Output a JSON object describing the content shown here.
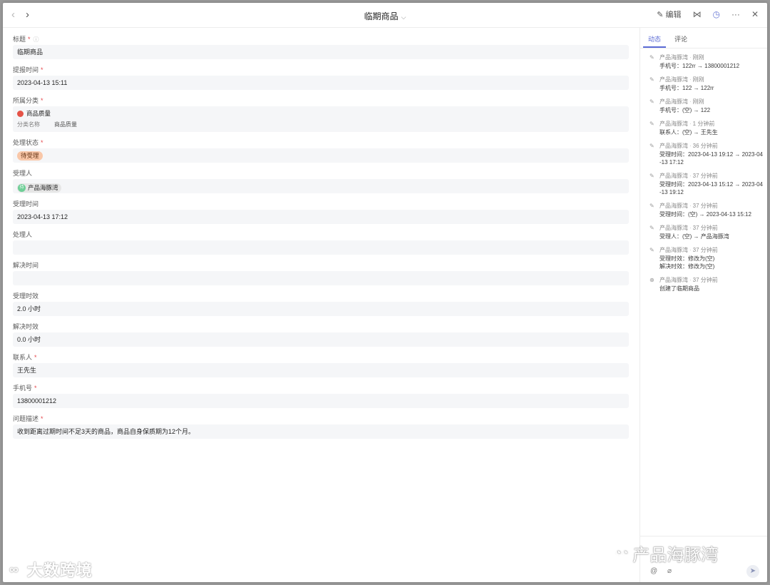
{
  "header": {
    "title": "临期商品",
    "edit_label": "编辑"
  },
  "form": {
    "title": {
      "label": "标题",
      "value": "临期商品"
    },
    "report_time": {
      "label": "提报时间",
      "value": "2023-04-13 15:11"
    },
    "category": {
      "label": "所属分类",
      "value": "商品质量",
      "sub_label": "分类名称",
      "sub_value": "商品质量"
    },
    "status": {
      "label": "处理状态",
      "value": "待受理"
    },
    "assignee": {
      "label": "受理人",
      "value": "产品海豚湾",
      "avatar": "待"
    },
    "accept_time": {
      "label": "受理时间",
      "value": "2023-04-13 17:12"
    },
    "handler": {
      "label": "处理人",
      "value": ""
    },
    "resolve_time": {
      "label": "解决时间",
      "value": ""
    },
    "accept_sla": {
      "label": "受理时效",
      "value": "2.0 小时"
    },
    "resolve_sla": {
      "label": "解决时效",
      "value": "0.0 小时"
    },
    "contact": {
      "label": "联系人",
      "value": "王先生"
    },
    "phone": {
      "label": "手机号",
      "value": "13800001212"
    },
    "description": {
      "label": "问题描述",
      "value": "收到距离过期时间不足3天的商品，商品自身保质期为12个月。"
    }
  },
  "panel": {
    "tabs": [
      "动态",
      "评论"
    ],
    "activity": [
      {
        "icon": "pencil-icon",
        "user": "产品海豚湾",
        "time": "刚刚",
        "body": "手机号：122rr → 13800001212"
      },
      {
        "icon": "pencil-icon",
        "user": "产品海豚湾",
        "time": "刚刚",
        "body": "手机号：122 → 122rr"
      },
      {
        "icon": "pencil-icon",
        "user": "产品海豚湾",
        "time": "刚刚",
        "body": "手机号：(空) → 122"
      },
      {
        "icon": "pencil-icon",
        "user": "产品海豚湾",
        "time": "1 分钟前",
        "body": "联系人：(空) → 王先生"
      },
      {
        "icon": "pencil-icon",
        "user": "产品海豚湾",
        "time": "36 分钟前",
        "body": "受理时间：2023-04-13 19:12 → 2023-04-13 17:12"
      },
      {
        "icon": "pencil-icon",
        "user": "产品海豚湾",
        "time": "37 分钟前",
        "body": "受理时间：2023-04-13 15:12 → 2023-04-13 19:12"
      },
      {
        "icon": "pencil-icon",
        "user": "产品海豚湾",
        "time": "37 分钟前",
        "body": "受理时间：(空) → 2023-04-13 15:12"
      },
      {
        "icon": "pencil-icon",
        "user": "产品海豚湾",
        "time": "37 分钟前",
        "body": "受理人：(空) → 产品海豚湾"
      },
      {
        "icon": "pencil-icon",
        "user": "产品海豚湾",
        "time": "37 分钟前",
        "body": "受理时效：修改为(空)",
        "body2": "解决时效：修改为(空)"
      },
      {
        "icon": "plus-circle-icon",
        "user": "产品海豚湾",
        "time": "37 分钟前",
        "body": "创建了临期商品"
      }
    ]
  },
  "watermarks": {
    "left": "大数跨境",
    "right": "产品海豚湾"
  },
  "colors": {
    "accent": "#5b6bd5",
    "required": "#e5484d",
    "status_tag": "#f9c7a8"
  }
}
